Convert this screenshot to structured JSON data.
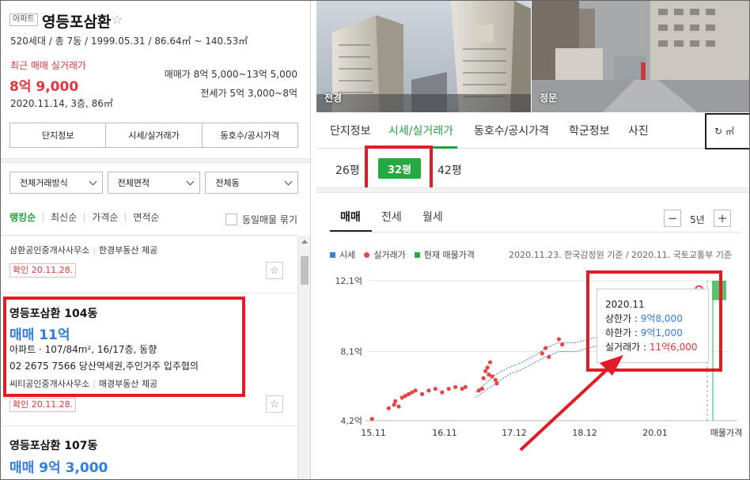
{
  "complex": {
    "tag": "아파트",
    "name": "영등포삼환",
    "meta": "520세대 / 총 7동 / 1999.05.31 / 86.64㎡ ~ 140.53㎡",
    "recent_label": "최근 매매 실거래가",
    "recent_price": "8억 9,000",
    "recent_date": "2020.11.14, 3층, 86㎡",
    "sale_range": "매매가 8억 5,000~13억 5,000",
    "jeonse_range": "전세가 5억 3,000~8억"
  },
  "left_buttons": [
    "단지정보",
    "시세/실거래가",
    "동호수/공시가격"
  ],
  "filters": [
    "전체거래방식",
    "전체면적",
    "전체동"
  ],
  "sorts": [
    "랭킹순",
    "최신순",
    "가격순",
    "면적순"
  ],
  "same_listing_label": "동일매물 묶기",
  "listings": [
    {
      "office": "삼환공인중개사사무소",
      "provider": "한경부동산 제공",
      "confirmed": "확인 20.11.28."
    },
    {
      "title": "영등포삼환 104동",
      "price": "매매 11억",
      "desc1": "아파트 · 107/84m², 16/17층, 동향",
      "desc2": "02 2675 7566 당산역세권,주인거주 입주협의",
      "office": "씨티공인중개사사무소",
      "provider": "매경부동산 제공",
      "confirmed": "확인 20.11.28."
    },
    {
      "title": "영등포삼환 107동",
      "price": "매매 9억 3,000"
    }
  ],
  "photos": [
    "전경",
    "정문"
  ],
  "tabs": [
    "단지정보",
    "시세/실거래가",
    "동호수/공시가격",
    "학군정보",
    "사진"
  ],
  "unit_button": "㎡",
  "pyeong": [
    "26평",
    "32평",
    "42평"
  ],
  "chart_tabs": [
    "매매",
    "전세",
    "월세"
  ],
  "period": "5년",
  "legend": {
    "market": "시세",
    "actual": "실거래가",
    "listing": "현재 매물가격",
    "source": "2020.11.23. 한국감정원 기준 / 2020.11. 국토교통부 기준"
  },
  "tooltip": {
    "date": "2020.11",
    "upper_label": "상한가 : ",
    "upper_value": "9억8,000",
    "lower_label": "하한가 : ",
    "lower_value": "9억1,000",
    "actual_label": "실거래가 : ",
    "actual_value": "11억6,000"
  },
  "colors": {
    "accent_green": "#27a942",
    "price_red": "#e0353b",
    "price_blue": "#2f7de0",
    "highlight_red": "#e21c26"
  },
  "chart_data": {
    "type": "scatter",
    "y_unit": "억",
    "yticks": [
      4.2,
      8.1,
      12.1
    ],
    "ytick_labels": [
      "4,2억",
      "8,1억",
      "12,1억"
    ],
    "xtick_labels": [
      "15.11",
      "16.11",
      "17.12",
      "18.12",
      "20.01",
      "매물가격"
    ],
    "ylim": [
      4.2,
      12.1
    ],
    "xlim": [
      2015.9,
      2020.95
    ],
    "series": [
      {
        "name": "실거래가",
        "points": [
          [
            2015.95,
            4.3
          ],
          [
            2016.2,
            4.9
          ],
          [
            2016.28,
            5.1
          ],
          [
            2016.3,
            5.3
          ],
          [
            2016.35,
            5.0
          ],
          [
            2016.4,
            5.5
          ],
          [
            2016.45,
            5.6
          ],
          [
            2016.5,
            5.7
          ],
          [
            2016.55,
            5.8
          ],
          [
            2016.6,
            5.9
          ],
          [
            2016.7,
            5.7
          ],
          [
            2016.8,
            5.9
          ],
          [
            2016.9,
            6.0
          ],
          [
            2017.0,
            5.8
          ],
          [
            2017.1,
            6.0
          ],
          [
            2017.2,
            6.1
          ],
          [
            2017.3,
            6.0
          ],
          [
            2017.35,
            6.1
          ],
          [
            2017.55,
            5.9
          ],
          [
            2017.6,
            6.0
          ],
          [
            2017.62,
            6.6
          ],
          [
            2017.65,
            7.0
          ],
          [
            2017.68,
            7.2
          ],
          [
            2017.7,
            6.8
          ],
          [
            2017.72,
            7.5
          ],
          [
            2017.75,
            6.7
          ],
          [
            2017.8,
            6.5
          ],
          [
            2017.82,
            6.3
          ],
          [
            2018.5,
            8.0
          ],
          [
            2018.55,
            8.3
          ],
          [
            2018.6,
            7.8
          ],
          [
            2018.75,
            8.8
          ],
          [
            2018.8,
            8.5
          ],
          [
            2020.85,
            11.6
          ]
        ]
      },
      {
        "name": "시세",
        "upper": [
          [
            2017.5,
            5.8
          ],
          [
            2017.8,
            6.8
          ],
          [
            2018.0,
            7.2
          ],
          [
            2018.2,
            7.5
          ],
          [
            2018.4,
            7.9
          ],
          [
            2018.55,
            8.3
          ],
          [
            2018.75,
            8.6
          ],
          [
            2019.0,
            8.6
          ],
          [
            2019.3,
            8.9
          ],
          [
            2019.6,
            9.2
          ],
          [
            2019.9,
            9.4
          ],
          [
            2020.2,
            9.5
          ],
          [
            2020.5,
            9.7
          ],
          [
            2020.85,
            9.8
          ]
        ],
        "lower": [
          [
            2017.5,
            5.5
          ],
          [
            2017.8,
            6.3
          ],
          [
            2018.0,
            6.8
          ],
          [
            2018.2,
            7.1
          ],
          [
            2018.4,
            7.5
          ],
          [
            2018.55,
            7.8
          ],
          [
            2018.75,
            8.1
          ],
          [
            2019.0,
            8.1
          ],
          [
            2019.3,
            8.4
          ],
          [
            2019.6,
            8.7
          ],
          [
            2019.9,
            8.9
          ],
          [
            2020.2,
            9.0
          ],
          [
            2020.5,
            9.1
          ],
          [
            2020.85,
            9.1
          ]
        ]
      },
      {
        "name": "현재 매물가격",
        "range": [
          11.0,
          12.1
        ]
      }
    ]
  }
}
